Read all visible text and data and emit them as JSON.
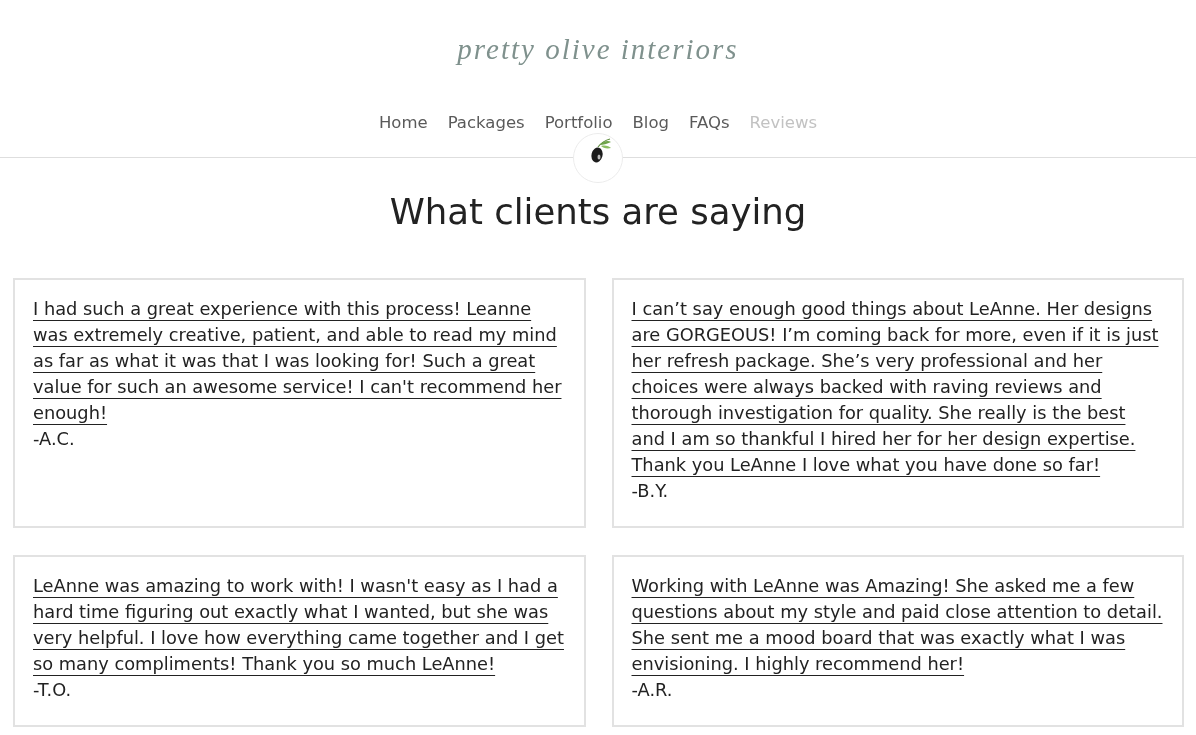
{
  "logo": {
    "text": "pretty olive interiors"
  },
  "nav": [
    {
      "label": "Home",
      "selected": false
    },
    {
      "label": "Packages",
      "selected": false
    },
    {
      "label": "Portfolio",
      "selected": false
    },
    {
      "label": "Blog",
      "selected": false
    },
    {
      "label": "FAQs",
      "selected": false
    },
    {
      "label": "Reviews",
      "selected": true
    }
  ],
  "heading": "What clients are saying",
  "reviews": [
    {
      "quote": "I had such a great experience with this process! Leanne was extremely creative, patient, and able to read my mind as far as what it was that I was looking for! Such a great value for such an awesome service! I can't recommend her enough!",
      "author": "-A.C."
    },
    {
      "quote": "I can’t say enough good things about LeAnne. Her designs are GORGEOUS! I’m coming back for more, even if it is just her refresh package. She’s very professional and her choices were always backed with raving reviews and thorough investigation for quality. She really is the best and I am so thankful I hired her for her design expertise. Thank you LeAnne I love what you have done so far!",
      "author": "-B.Y."
    },
    {
      "quote": "LeAnne was amazing to work with! I wasn't easy as I had a hard time figuring out exactly what I wanted, but she was very helpful. I love how everything came together and I get so many compliments! Thank you so much LeAnne!",
      "author": "-T.O."
    },
    {
      "quote": "Working with LeAnne was Amazing! She asked me a few questions about my style and paid close attention to detail. She sent me a mood board that was exactly what I was envisioning. I highly recommend her!",
      "author": "-A.R."
    }
  ]
}
